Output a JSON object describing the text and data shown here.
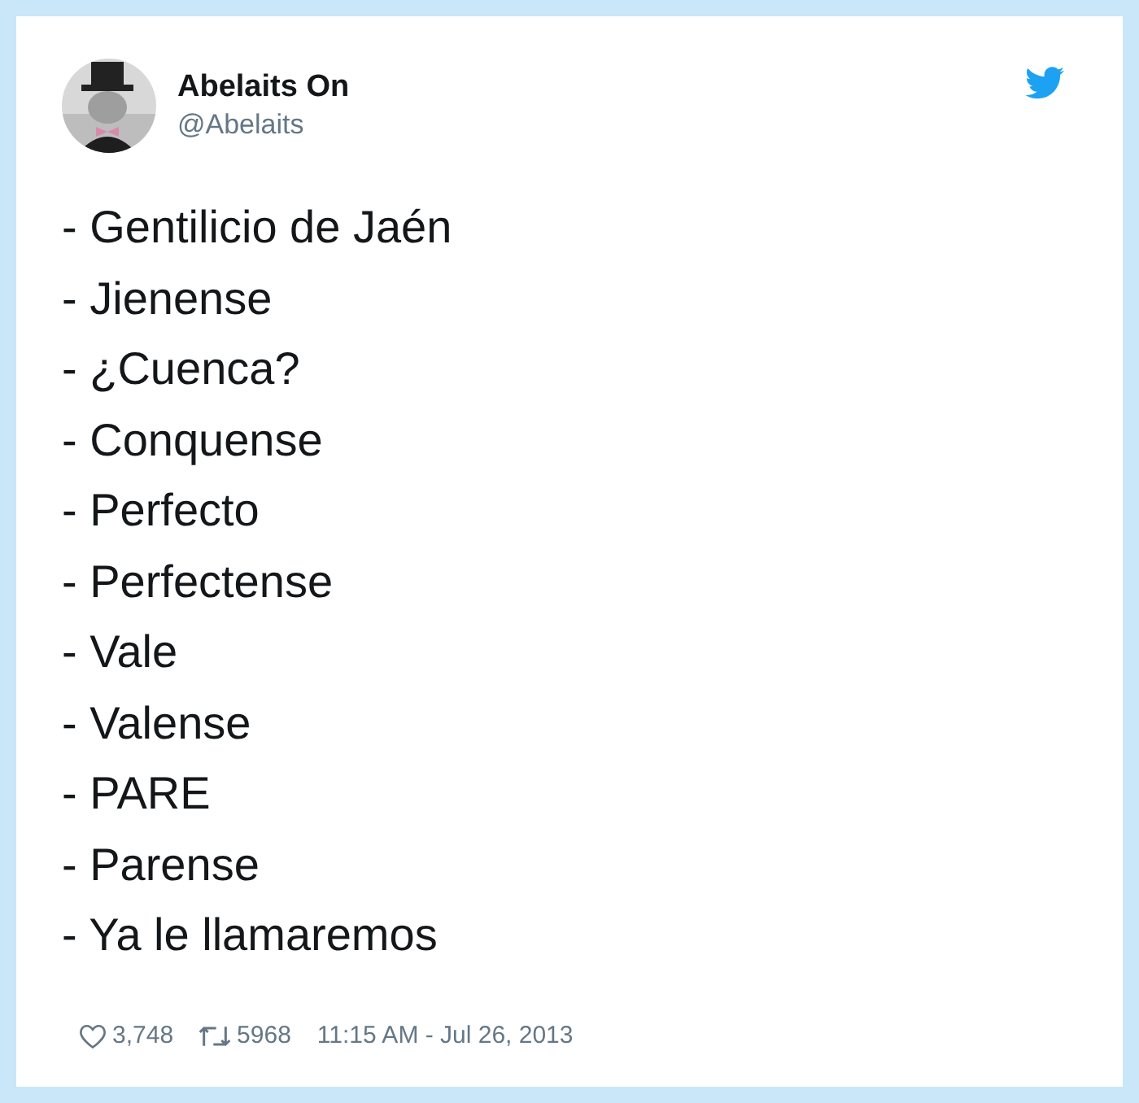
{
  "author": {
    "name": "Abelaits On",
    "handle": "@Abelaits"
  },
  "lines": [
    "- Gentilicio de Jaén",
    "- Jienense",
    "- ¿Cuenca?",
    "- Conquense",
    "- Perfecto",
    "- Perfectense",
    "- Vale",
    "- Valense",
    "- PARE",
    "- Parense",
    "- Ya le llamaremos"
  ],
  "footer": {
    "likes": "3,748",
    "retweets": "5968",
    "timestamp": "11:15 AM - Jul 26, 2013"
  }
}
